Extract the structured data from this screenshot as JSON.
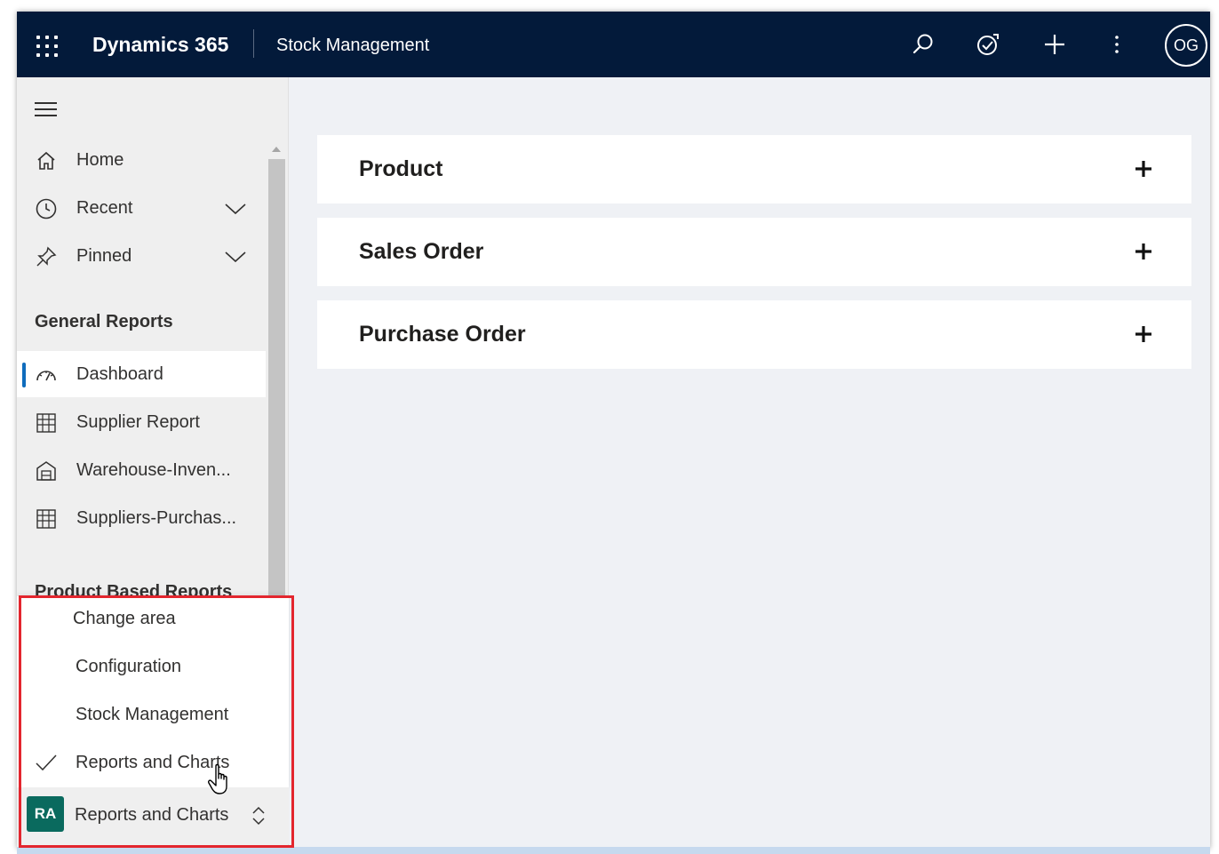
{
  "topbar": {
    "app_name": "Dynamics 365",
    "area_title": "Stock Management",
    "avatar_initials": "OG",
    "icons": [
      "waffle-icon",
      "search-icon",
      "assistant-icon",
      "add-icon",
      "more-icon"
    ]
  },
  "sidebar": {
    "nav": {
      "home": "Home",
      "recent": "Recent",
      "pinned": "Pinned"
    },
    "groups": {
      "general": "General Reports",
      "product_based": "Product Based Reports"
    },
    "items": {
      "dashboard": "Dashboard",
      "supplier_report": "Supplier Report",
      "warehouse": "Warehouse-Inven...",
      "suppliers_purchase": "Suppliers-Purchas..."
    },
    "area_menu": {
      "header": "Change area",
      "configuration": "Configuration",
      "stock_management": "Stock Management",
      "reports_and_charts": "Reports and Charts"
    },
    "area_switcher": {
      "badge": "RA",
      "label": "Reports and Charts"
    }
  },
  "main": {
    "panels": {
      "product": "Product",
      "sales_order": "Sales Order",
      "purchase_order": "Purchase Order"
    }
  },
  "colors": {
    "topbar_bg": "#031a3a",
    "selection_bar": "#0f6cbd",
    "area_badge": "#0a6a5e",
    "highlight_box": "#e3262e"
  }
}
